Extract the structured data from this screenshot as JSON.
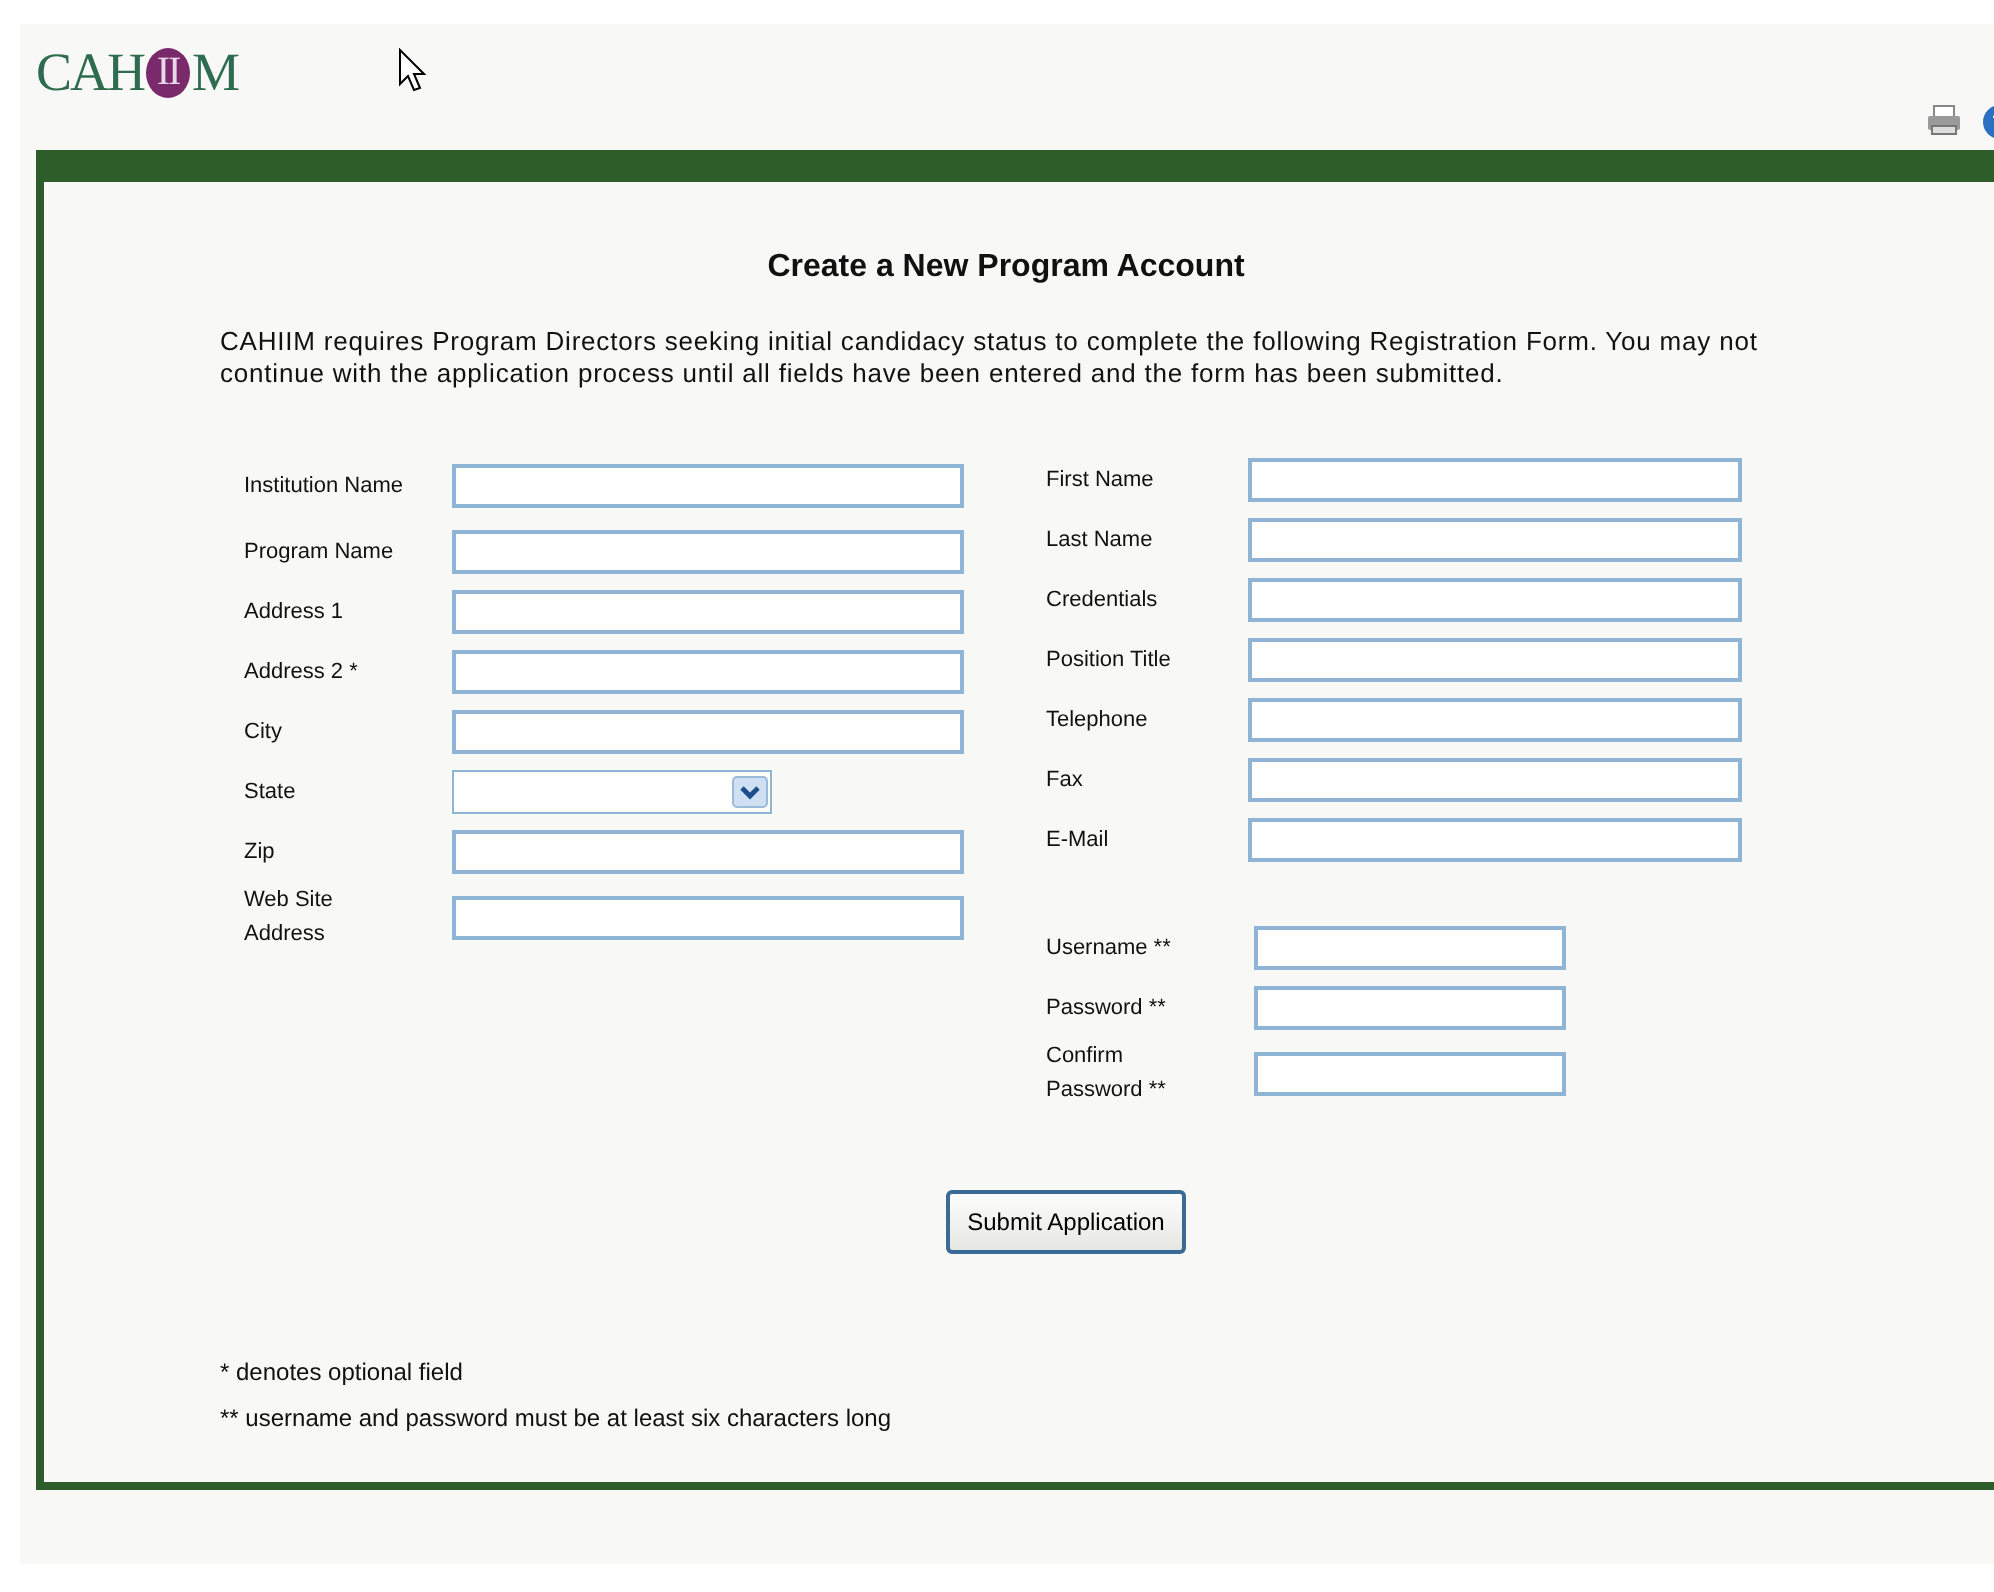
{
  "logo": {
    "prefix": "CAH",
    "mark": "II",
    "suffix": "M"
  },
  "title": "Create a New Program Account",
  "intro": "CAHIIM requires Program Directors seeking initial candidacy status to complete the following Registration Form. You may not continue with the application process until all fields have been entered and the form has been submitted.",
  "institution_fields": [
    {
      "label": "Institution Name",
      "kind": "text"
    },
    {
      "label": "Program Name",
      "kind": "text"
    },
    {
      "label": "Address 1",
      "kind": "text"
    },
    {
      "label": "Address 2 *",
      "kind": "text"
    },
    {
      "label": "City",
      "kind": "text"
    },
    {
      "label": "State",
      "kind": "select"
    },
    {
      "label": "Zip",
      "kind": "text"
    },
    {
      "label": "Web Site Address",
      "kind": "text"
    }
  ],
  "contact_fields": [
    {
      "label": "First Name",
      "kind": "text"
    },
    {
      "label": "Last Name",
      "kind": "text"
    },
    {
      "label": "Credentials",
      "kind": "text"
    },
    {
      "label": "Position Title",
      "kind": "text"
    },
    {
      "label": "Telephone",
      "kind": "text"
    },
    {
      "label": "Fax",
      "kind": "text"
    },
    {
      "label": "E-Mail",
      "kind": "text"
    }
  ],
  "login_fields": [
    {
      "label": "Username **",
      "kind": "text"
    },
    {
      "label": "Password **",
      "kind": "text"
    },
    {
      "label": "Confirm Password **",
      "kind": "text"
    }
  ],
  "submit_button": "Submit Application",
  "notes": [
    "* denotes optional field",
    "** username and password must be at least six characters long"
  ]
}
